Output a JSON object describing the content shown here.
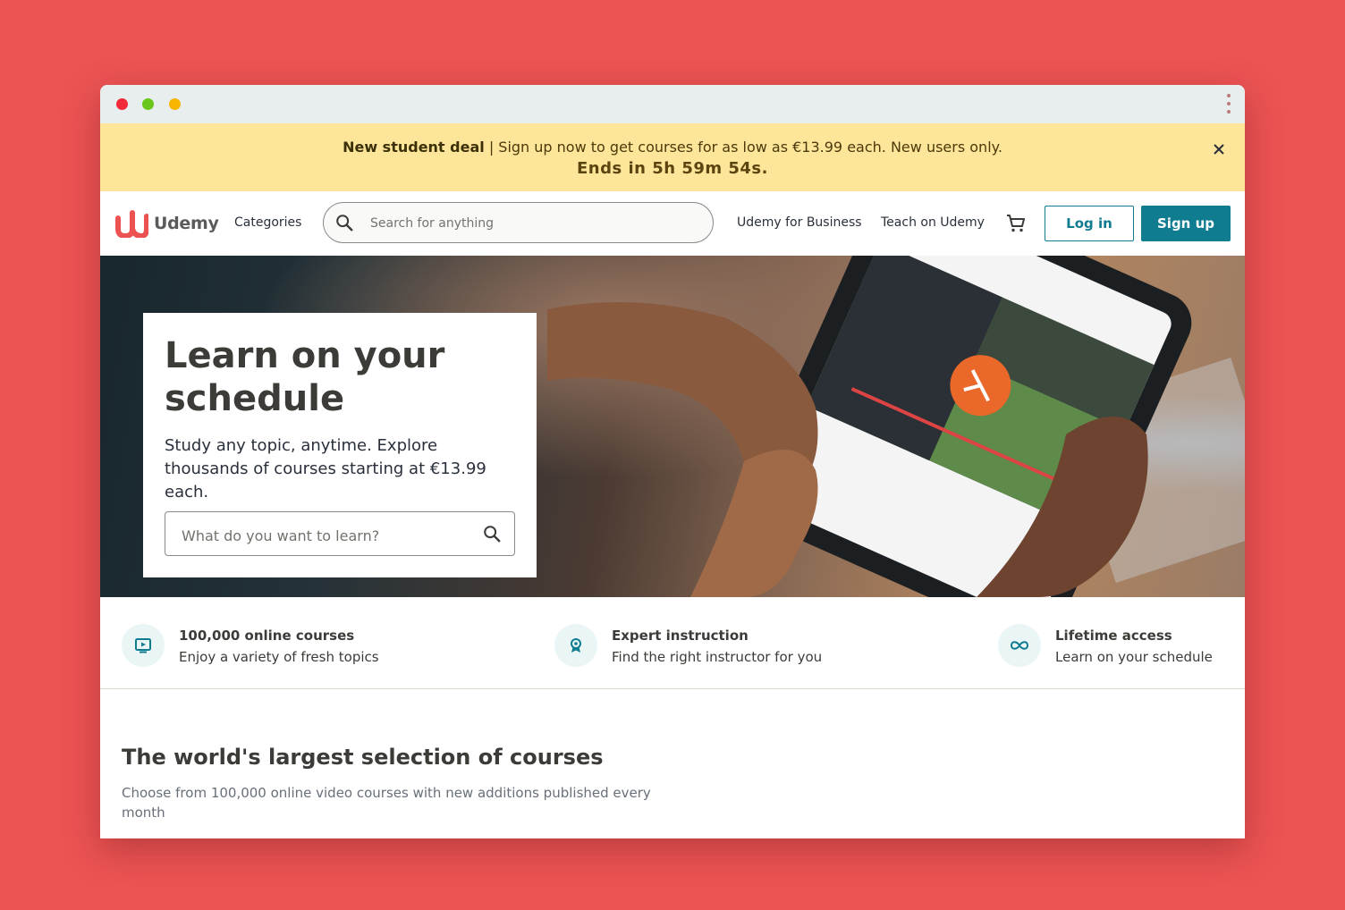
{
  "banner": {
    "deal_label": "New student deal",
    "deal_text": " | Sign up now to get courses for as low as €13.99 each. New users only.",
    "countdown": "Ends in 5h 59m 54s.",
    "close_icon": "close-icon"
  },
  "header": {
    "brand": "Udemy",
    "categories": "Categories",
    "search_placeholder": "Search for anything",
    "business": "Udemy for Business",
    "teach": "Teach on Udemy",
    "login": "Log in",
    "signup": "Sign up"
  },
  "hero": {
    "title": "Learn on your schedule",
    "subtitle": "Study any topic, anytime. Explore thousands of courses starting at €13.99 each.",
    "search_placeholder": "What do you want to learn?"
  },
  "features": [
    {
      "icon": "video-icon",
      "title": "100,000 online courses",
      "subtitle": "Enjoy a variety of fresh topics"
    },
    {
      "icon": "badge-icon",
      "title": "Expert instruction",
      "subtitle": "Find the right instructor for you"
    },
    {
      "icon": "infinity-icon",
      "title": "Lifetime access",
      "subtitle": "Learn on your schedule"
    }
  ],
  "section": {
    "title": "The world's largest selection of courses",
    "subtitle": "Choose from 100,000 online video courses with new additions published every month"
  },
  "colors": {
    "page_background": "#ec5353",
    "banner": "#fde599",
    "accent": "#0f7c90",
    "brand_red": "#ec5252"
  }
}
